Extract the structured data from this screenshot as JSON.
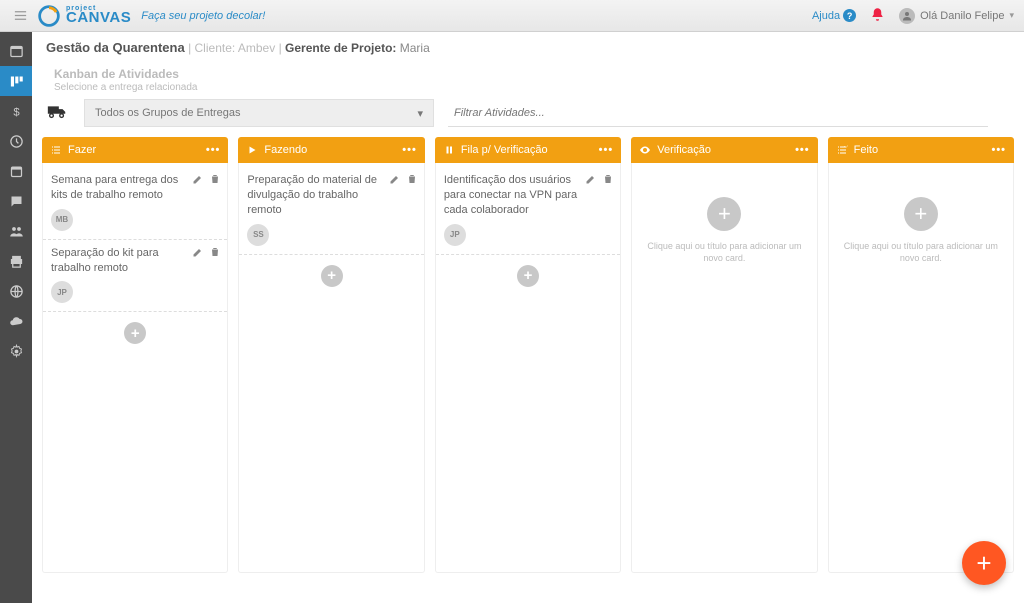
{
  "brand": {
    "small": "project",
    "big": "CANVAS",
    "tagline": "Faça seu projeto decolar!"
  },
  "header": {
    "help": "Ajuda",
    "user_greeting": "Olá Danilo Felipe"
  },
  "project": {
    "title": "Gestão da Quarentena",
    "client_label": "Cliente:",
    "client_name": "Ambev",
    "pm_label": "Gerente de Projeto:",
    "pm_name": "Maria"
  },
  "section": {
    "title": "Kanban de Atividades",
    "subtitle": "Selecione a entrega relacionada"
  },
  "filters": {
    "delivery_group": "Todos os Grupos de Entregas",
    "search_placeholder": "Filtrar Atividades..."
  },
  "empty_column_text": "Clique aqui ou título para adicionar um novo card.",
  "columns": [
    {
      "title": "Fazer",
      "icon": "list",
      "cards": [
        {
          "text": "Semana para entrega dos kits de trabalho remoto",
          "avatar": "MB"
        },
        {
          "text": "Separação do kit para trabalho remoto",
          "avatar": "JP"
        }
      ]
    },
    {
      "title": "Fazendo",
      "icon": "play",
      "cards": [
        {
          "text": "Preparação do material de divulgação do trabalho remoto",
          "avatar": "SS"
        }
      ]
    },
    {
      "title": "Fila p/ Verificação",
      "icon": "pause",
      "cards": [
        {
          "text": "Identificação dos usuários para conectar na VPN para cada colaborador",
          "avatar": "JP"
        }
      ]
    },
    {
      "title": "Verificação",
      "icon": "eye",
      "cards": []
    },
    {
      "title": "Feito",
      "icon": "check",
      "cards": []
    }
  ]
}
